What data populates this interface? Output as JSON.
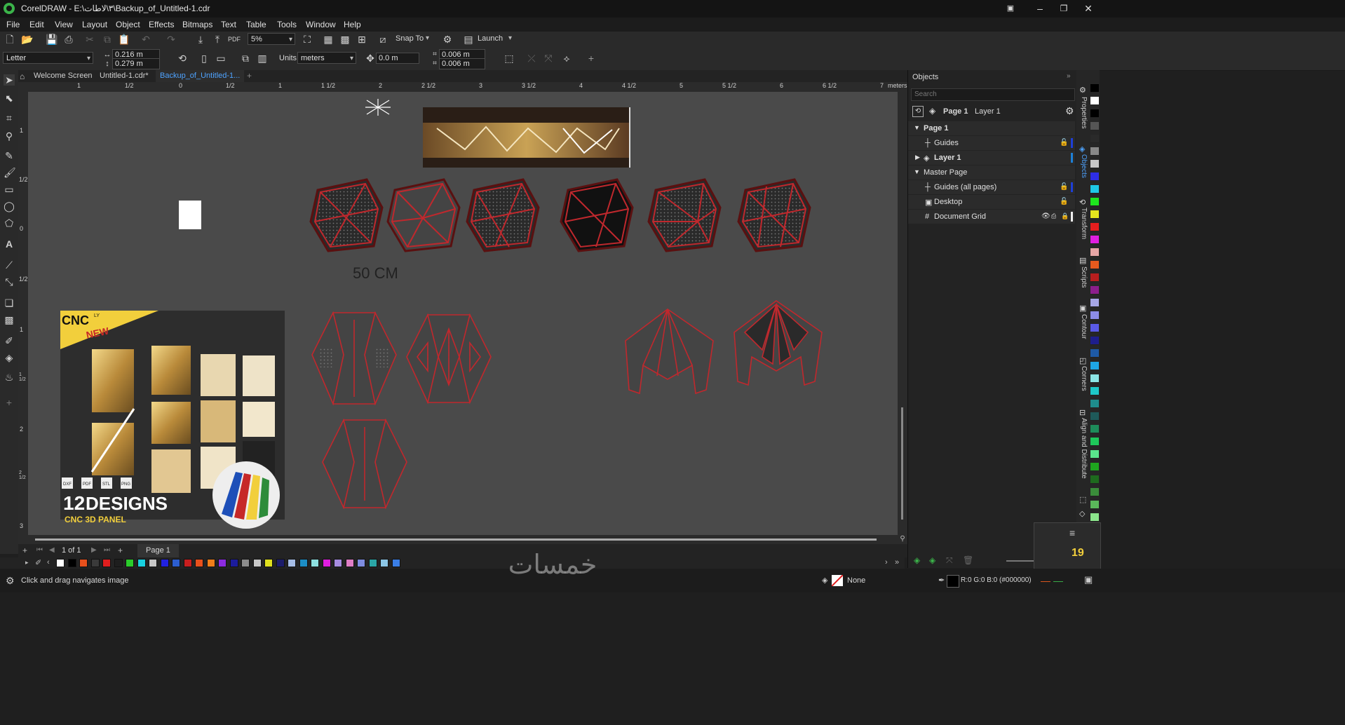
{
  "app": {
    "title": "CorelDRAW - E:\\٣\\لاطات\\Backup_of_Untitled-1.cdr"
  },
  "menu": [
    "File",
    "Edit",
    "View",
    "Layout",
    "Object",
    "Effects",
    "Bitmaps",
    "Text",
    "Table",
    "Tools",
    "Window",
    "Help"
  ],
  "toolbar": {
    "zoom": "5%",
    "snap_to": "Snap To",
    "launch": "Launch"
  },
  "propbar": {
    "page_size": "Letter",
    "width": "0.216 m",
    "height": "0.279 m",
    "units_label": "Units:",
    "units": "meters",
    "nudge": "0.0 m",
    "dup_x": "0.006 m",
    "dup_y": "0.006 m"
  },
  "tabs": [
    "Welcome Screen",
    "Untitled-1.cdr*",
    "Backup_of_Untitled-1..."
  ],
  "ruler": {
    "h_ticks": [
      "1",
      "1/2",
      "0",
      "1/2",
      "1",
      "1 1/2",
      "2",
      "2 1/2",
      "3",
      "3 1/2",
      "4",
      "4 1/2",
      "5",
      "5 1/2",
      "6",
      "6 1/2",
      "7"
    ],
    "unit": "meters",
    "v_ticks": [
      "1",
      "1/2",
      "0",
      "1/2",
      "1",
      "1 1/2",
      "2",
      "2 1/2",
      "3"
    ]
  },
  "canvas": {
    "label_50cm": "50 CM",
    "promo": {
      "brand": "CNC",
      "brand_sup": "LY",
      "badge": "NEW",
      "formats": [
        "DXF",
        "PDF",
        "STL",
        "PNG"
      ],
      "count": "12",
      "headline": "DESIGNS",
      "footer": "CNC 3D PANEL"
    }
  },
  "pager": {
    "position": "1 of 1",
    "page_tab": "Page 1"
  },
  "objects_panel": {
    "title": "Objects",
    "search_placeholder": "Search",
    "current_page": "Page 1",
    "current_layer": "Layer 1",
    "tree": [
      "Page 1",
      "Guides",
      "Layer 1",
      "Master Page",
      "Guides (all pages)",
      "Desktop",
      "Document Grid"
    ]
  },
  "side_tabs": [
    "Properties",
    "Objects",
    "Transform",
    "Scripts",
    "Contour",
    "Corners",
    "Align and Distribute"
  ],
  "status": {
    "hint": "Click and drag navigates image",
    "fill": "None",
    "color": "R:0 G:0 B:0 (#000000)",
    "counter": "19"
  },
  "watermark": "خمسات",
  "colors": {
    "accent": "#1e7fd6",
    "outline": "#c0282d",
    "canvas": "#4a4a4a"
  },
  "palette": [
    "#ffffff",
    "#000000",
    "#e8501c",
    "#3a3a3a",
    "#e01e1e",
    "#1e1e1e",
    "#2bcc2b",
    "#19d1e0",
    "#c8c8c8",
    "#2121e0",
    "#2c5ecf",
    "#c81e1e",
    "#e8501c",
    "#f07e1a",
    "#8c2be0",
    "#1c1c9c",
    "#8c8c8c",
    "#c8c8c8",
    "#e0e01e",
    "#1c1c6a",
    "#a6bde6",
    "#1c8ec6",
    "#8ee0e0",
    "#e01ee0",
    "#a68ce0",
    "#e07ec6",
    "#7e8ce0",
    "#2ba6a6",
    "#8cc6e6",
    "#3a7ee6"
  ],
  "right_palette": [
    "#000000",
    "#ffffff",
    "#000000",
    "#555555",
    "#2a2a2a",
    "#888888",
    "#c8c8c8",
    "#2e2ee6",
    "#1ec8e6",
    "#1ee61e",
    "#e6e61e",
    "#e61e1e",
    "#e01ee0",
    "#e6a6a6",
    "#e65a1e",
    "#b81e1e",
    "#8c1e8c",
    "#a6a6e6",
    "#8c8ce6",
    "#5a5ae6",
    "#1e1e8c",
    "#1e5aa6",
    "#1ea6e6",
    "#8ce6e6",
    "#1ec8c8",
    "#1e8c8c",
    "#1e5a5a",
    "#1e8c5a",
    "#1ec85a",
    "#5ae68c",
    "#1ea61e",
    "#1e6a1e",
    "#3a8c3a",
    "#5ab85a",
    "#8ce68c"
  ]
}
